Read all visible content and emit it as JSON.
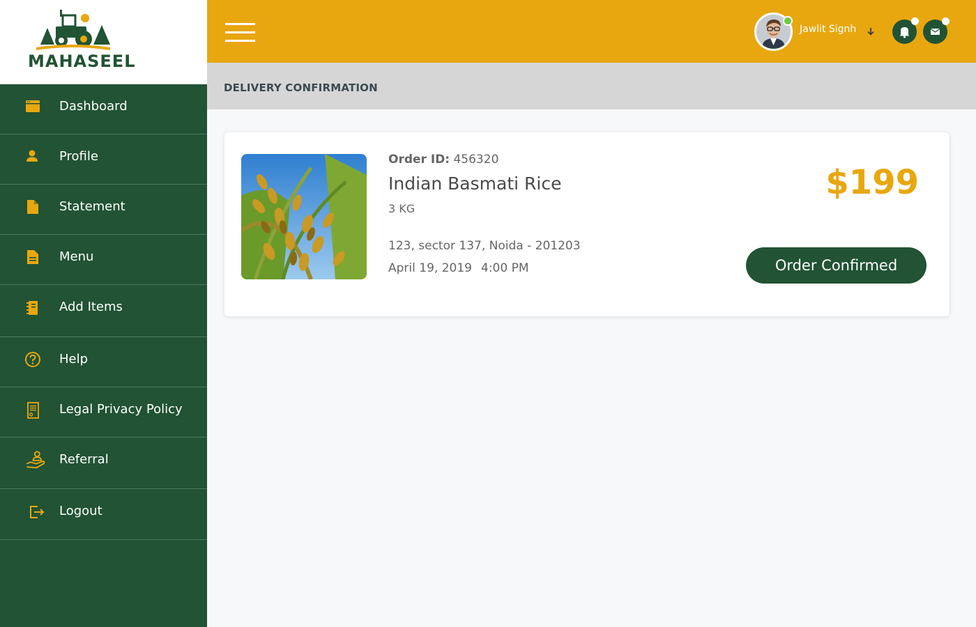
{
  "brand": {
    "name": "MAHASEEL"
  },
  "colors": {
    "sidebar": "#215334",
    "accent": "#e8a70f",
    "subheader": "#d6d6d6"
  },
  "sidebar": {
    "items": [
      {
        "label": "Dashboard",
        "icon": "dashboard-icon"
      },
      {
        "label": "Profile",
        "icon": "user-icon"
      },
      {
        "label": "Statement",
        "icon": "file-icon"
      },
      {
        "label": "Menu",
        "icon": "document-icon"
      },
      {
        "label": "Add Items",
        "icon": "notebook-icon"
      },
      {
        "label": "Help",
        "icon": "help-icon"
      },
      {
        "label": "Legal Privacy Policy",
        "icon": "certificate-icon"
      },
      {
        "label": "Referral",
        "icon": "hand-user-icon"
      },
      {
        "label": "Logout",
        "icon": "logout-icon"
      }
    ]
  },
  "header": {
    "user_name": "Jawlit Signh",
    "icons": [
      "menu-icon",
      "bell-icon",
      "mail-icon",
      "arrow-down-icon"
    ]
  },
  "page": {
    "title": "DELIVERY CONFIRMATION"
  },
  "order": {
    "id_label": "Order ID:",
    "id": "456320",
    "product_name": "Indian Basmati Rice",
    "quantity": "3 KG",
    "address": "123, sector 137, Noida - 201203",
    "date": "April 19, 2019",
    "time": "4:00 PM",
    "price": "$199",
    "status_button": "Order Confirmed"
  }
}
